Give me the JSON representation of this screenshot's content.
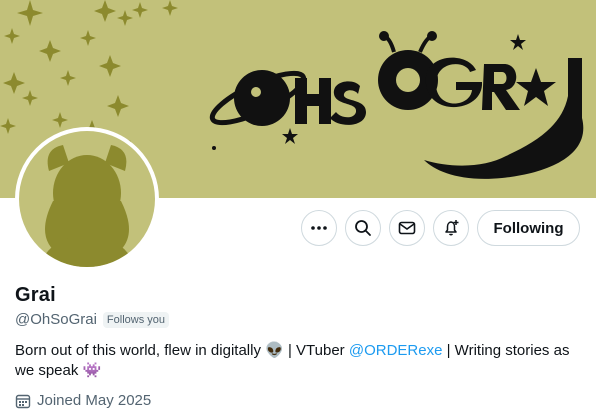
{
  "banner": {
    "logo_text": "OHSOGRAI",
    "background_color": "#c2c17a"
  },
  "profile": {
    "display_name": "Grai",
    "handle": "@OhSoGrai",
    "follows_you": "Follows you",
    "bio": {
      "part1": "Born out of this world, flew in digitally ",
      "emoji1": "👽",
      "part2": " | VTuber ",
      "mention": "@ORDERexe",
      "part3": " | Writing stories as we speak ",
      "emoji2": "👾"
    },
    "joined": "Joined May 2025"
  },
  "actions": {
    "more_icon": "more-icon",
    "search_icon": "search-icon",
    "message_icon": "envelope-icon",
    "notify_icon": "bell-plus-icon",
    "follow_label": "Following"
  },
  "colors": {
    "mention": "#1d9bf0",
    "secondary_text": "#536471",
    "button_border": "#cfd9de"
  }
}
